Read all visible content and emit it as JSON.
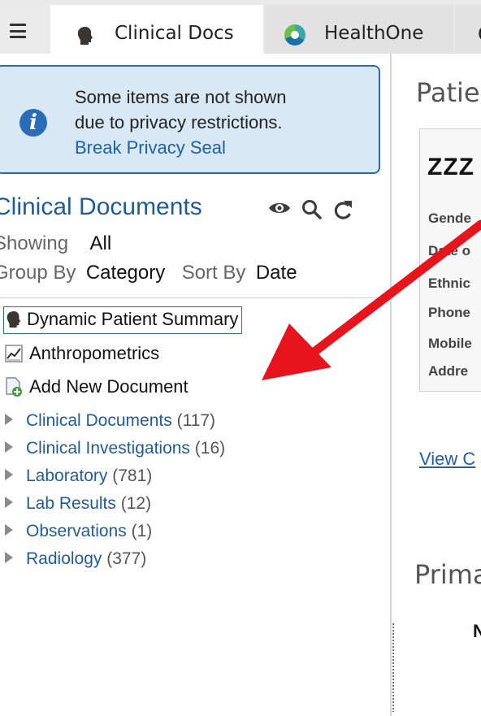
{
  "tabs": [
    {
      "label": "Clinical Docs",
      "active": true,
      "icon": "head-silhouette-icon"
    },
    {
      "label": "HealthOne",
      "active": false,
      "icon": "healthone-logo-icon"
    },
    {
      "label": "C",
      "active": false
    }
  ],
  "privacy": {
    "line1": "Some items are not shown",
    "line2": "due to privacy restrictions.",
    "link": "Break Privacy Seal"
  },
  "documents": {
    "title": "Clinical Documents",
    "showing_label": "Showing",
    "showing_value": "All",
    "group_label": "Group By",
    "group_value": "Category",
    "sort_label": "Sort By",
    "sort_value": "Date"
  },
  "items": {
    "summary": "Dynamic Patient Summary",
    "anthropometrics": "Anthropometrics",
    "add_new": "Add New Document"
  },
  "tree": [
    {
      "name": "Clinical Documents",
      "count": "(117)"
    },
    {
      "name": "Clinical Investigations",
      "count": "(16)"
    },
    {
      "name": "Laboratory",
      "count": "(781)"
    },
    {
      "name": "Lab Results",
      "count": "(12)"
    },
    {
      "name": "Observations",
      "count": "(1)"
    },
    {
      "name": "Radiology",
      "count": "(377)"
    }
  ],
  "right": {
    "title": "Patie",
    "patient_name": "ZZZ",
    "fields": [
      "Gende",
      "Date o",
      "Ethnic",
      "Phone",
      "Mobile",
      "Addre"
    ],
    "view_link": "View C",
    "primary_title": "Prima",
    "n_label": "N"
  },
  "colors": {
    "accent": "#1f5c99",
    "info_bg": "#d9e8f5",
    "arrow": "#e8141b"
  }
}
